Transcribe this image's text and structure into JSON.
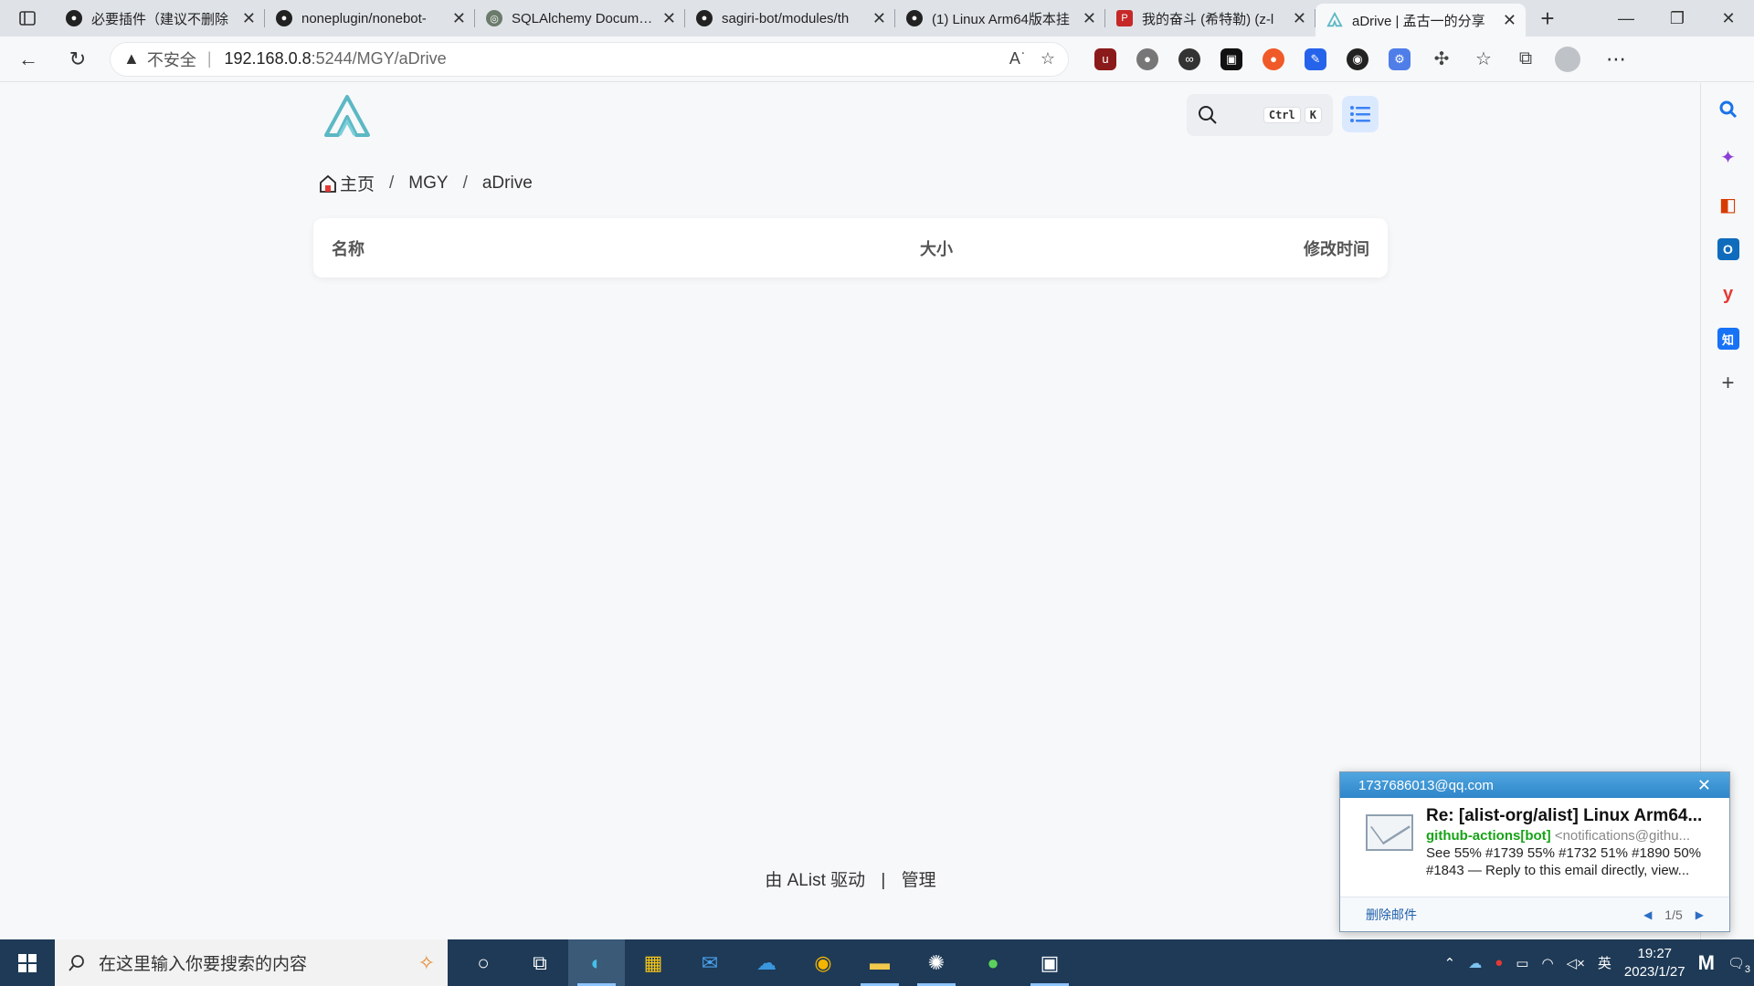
{
  "browser": {
    "tabs": [
      {
        "title": "必要插件（建议不删除",
        "favicon": "github-icon",
        "active": false
      },
      {
        "title": "noneplugin/nonebot-",
        "favicon": "github-icon",
        "active": false
      },
      {
        "title": "SQLAlchemy Documen",
        "favicon": "sqlalchemy-icon",
        "active": false
      },
      {
        "title": "sagiri-bot/modules/th",
        "favicon": "github-icon",
        "active": false
      },
      {
        "title": "(1) Linux Arm64版本挂",
        "favicon": "github-icon",
        "active": false
      },
      {
        "title": "我的奋斗 (希特勒) (z-l",
        "favicon": "pdf-icon",
        "active": false
      },
      {
        "title": "aDrive | 孟古一的分享",
        "favicon": "alist-icon",
        "active": true
      }
    ],
    "address": {
      "security_label": "不安全",
      "host": "192.168.0.8",
      "path": ":5244/MGY/aDrive"
    }
  },
  "page": {
    "search": {
      "key1": "Ctrl",
      "key2": "K"
    },
    "breadcrumb": {
      "home": "主页",
      "items": [
        "MGY",
        "aDrive"
      ]
    },
    "table": {
      "col_name": "名称",
      "col_size": "大小",
      "col_modified": "修改时间"
    },
    "footer": {
      "powered": "由 AList 驱动",
      "divider": "|",
      "manage": "管理"
    },
    "accent_color": "#3b82f6"
  },
  "notification": {
    "account": "1737686013@qq.com",
    "subject": "Re: [alist-org/alist] Linux Arm64...",
    "sender_name": "github-actions[bot]",
    "sender_addr": "<notifications@githu...",
    "preview": "See 55% #1739 55% #1732 51% #1890 50% #1843 — Reply to this email directly, view...",
    "delete_label": "删除邮件",
    "pager": "1/5"
  },
  "taskbar": {
    "search_placeholder": "在这里输入你要搜索的内容",
    "time": "19:27",
    "date": "2023/1/27",
    "ime": "英",
    "notifications_count": "3"
  }
}
